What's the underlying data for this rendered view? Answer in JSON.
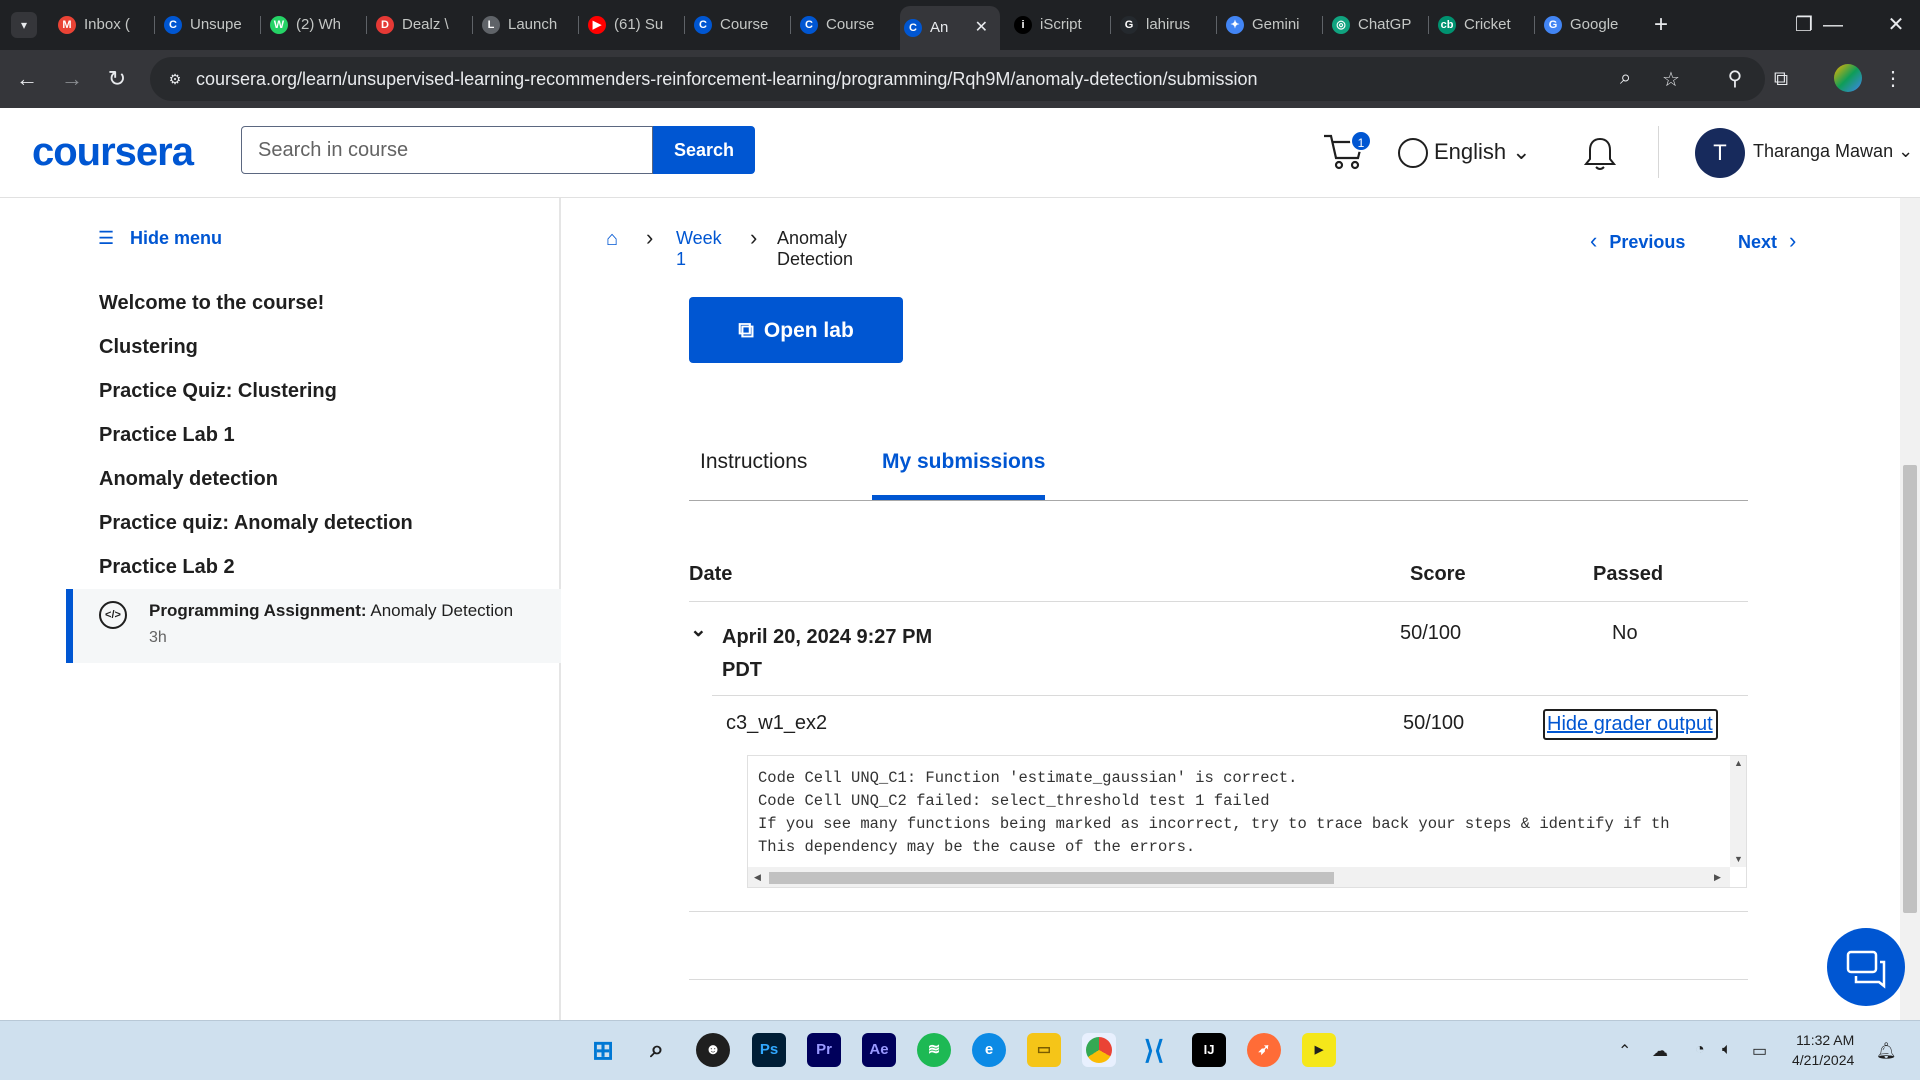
{
  "browser": {
    "tabs": [
      {
        "label": "Inbox (",
        "icon": "gmail-icon",
        "color": "#ea4335",
        "glyph": "M"
      },
      {
        "label": "Unsupe",
        "icon": "coursera-icon",
        "color": "#0056d2",
        "glyph": "C"
      },
      {
        "label": "(2) Wh",
        "icon": "whatsapp-icon",
        "color": "#25d366",
        "glyph": "W"
      },
      {
        "label": "Dealz \\",
        "icon": "dealz-icon",
        "color": "#e53935",
        "glyph": "D"
      },
      {
        "label": "Launch",
        "icon": "launch-icon",
        "color": "#5f6368",
        "glyph": "L"
      },
      {
        "label": "(61) Su",
        "icon": "youtube-icon",
        "color": "#ff0000",
        "glyph": "▶"
      },
      {
        "label": "Course",
        "icon": "coursera-icon",
        "color": "#0056d2",
        "glyph": "C"
      },
      {
        "label": "Course",
        "icon": "coursera-icon",
        "color": "#0056d2",
        "glyph": "C"
      },
      {
        "label": "An",
        "icon": "coursera-icon",
        "color": "#0056d2",
        "glyph": "C",
        "active": true
      },
      {
        "label": "iScript",
        "icon": "iscript-icon",
        "color": "#000000",
        "glyph": "i"
      },
      {
        "label": "lahirus",
        "icon": "github-icon",
        "color": "#24292e",
        "glyph": "G"
      },
      {
        "label": "Gemini",
        "icon": "gemini-icon",
        "color": "#4285f4",
        "glyph": "✦"
      },
      {
        "label": "ChatGP",
        "icon": "chatgpt-icon",
        "color": "#10a37f",
        "glyph": "◎"
      },
      {
        "label": "Cricket",
        "icon": "cricbuzz-icon",
        "color": "#009270",
        "glyph": "cb"
      },
      {
        "label": "Google",
        "icon": "google-translate-icon",
        "color": "#4285f4",
        "glyph": "G"
      }
    ],
    "url": "coursera.org/learn/unsupervised-learning-recommenders-reinforcement-learning/programming/Rqh9M/anomaly-detection/submission"
  },
  "header": {
    "logo": "coursera",
    "search_placeholder": "Search in course",
    "search_button": "Search",
    "cart_count": "1",
    "language": "English",
    "avatar_initial": "T",
    "user_name": "Tharanga Mawan"
  },
  "sidebar": {
    "hide_menu": "Hide menu",
    "items": [
      "Welcome to the course!",
      "Clustering",
      "Practice Quiz: Clustering",
      "Practice Lab 1",
      "Anomaly detection",
      "Practice quiz: Anomaly detection",
      "Practice Lab 2"
    ],
    "active": {
      "type": "Programming Assignment:",
      "title": "Anomaly Detection",
      "duration": "3h"
    }
  },
  "main": {
    "breadcrumb": {
      "week": "Week 1",
      "current": "Anomaly Detection"
    },
    "previous": "Previous",
    "next": "Next",
    "open_lab": "Open lab",
    "tabs": {
      "instructions": "Instructions",
      "submissions": "My submissions"
    },
    "table": {
      "headers": {
        "date": "Date",
        "score": "Score",
        "passed": "Passed"
      },
      "submission": {
        "date": "April 20, 2024 9:27 PM PDT",
        "score": "50/100",
        "passed": "No"
      },
      "part": {
        "name": "c3_w1_ex2",
        "score": "50/100",
        "action": "Hide grader output"
      }
    },
    "grader_output": "Code Cell UNQ_C1: Function 'estimate_gaussian' is correct.\nCode Cell UNQ_C2 failed: select_threshold test 1 failed\nIf you see many functions being marked as incorrect, try to trace back your steps & identify if th\nThis dependency may be the cause of the errors."
  },
  "taskbar": {
    "time": "11:32 AM",
    "date": "4/21/2024"
  },
  "colors": {
    "accent": "#0056d2",
    "chrome_dark": "#35363a",
    "taskbar": "#cfe0ee"
  }
}
